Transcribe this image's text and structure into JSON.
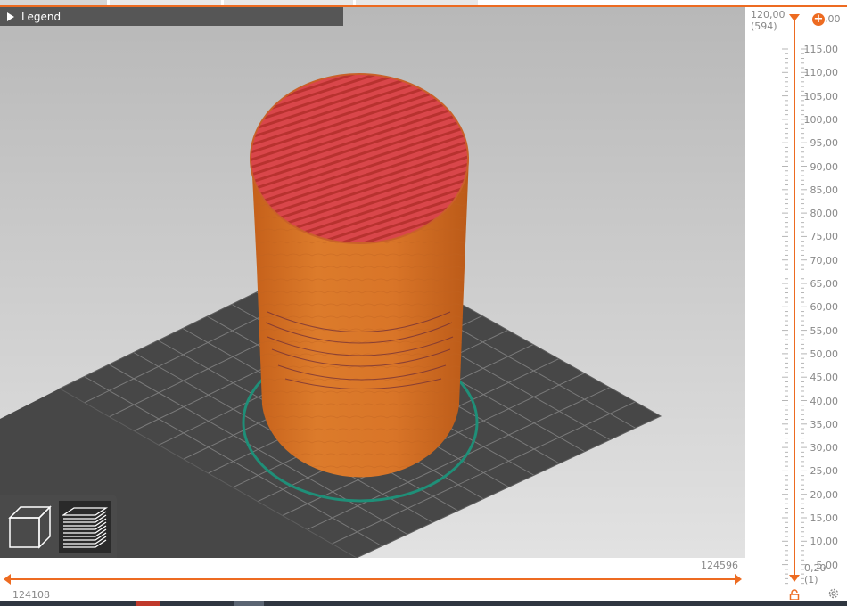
{
  "legend": {
    "label": "Legend"
  },
  "vertical_slider": {
    "top_value": "120,00",
    "top_layer": "(594)",
    "bottom_value": "0,20",
    "bottom_layer": "(1)",
    "ticks": [
      "115,00",
      "110,00",
      "105,00",
      "100,00",
      "95,00",
      "90,00",
      "85,00",
      "80,00",
      "75,00",
      "70,00",
      "65,00",
      "60,00",
      "55,00",
      "50,00",
      "45,00",
      "40,00",
      "35,00",
      "30,00",
      "25,00",
      "20,00",
      "15,00",
      "10,00",
      "5,00"
    ],
    "thumb_top_label": ",00"
  },
  "horizontal_slider": {
    "right_value": "124596",
    "left_value": "124108"
  },
  "view_buttons": [
    {
      "name": "3d-view"
    },
    {
      "name": "layers-view",
      "selected": true
    }
  ],
  "icons": {
    "legend": "triangle-right-icon",
    "add": "plus-circle-icon",
    "lock": "lock-icon",
    "settings": "gear-icon"
  },
  "colors": {
    "accent": "#ed6b21",
    "model": "#d9772a",
    "top_surface": "#d94b41",
    "skirt": "#1f8f78",
    "bed": "#474747"
  }
}
